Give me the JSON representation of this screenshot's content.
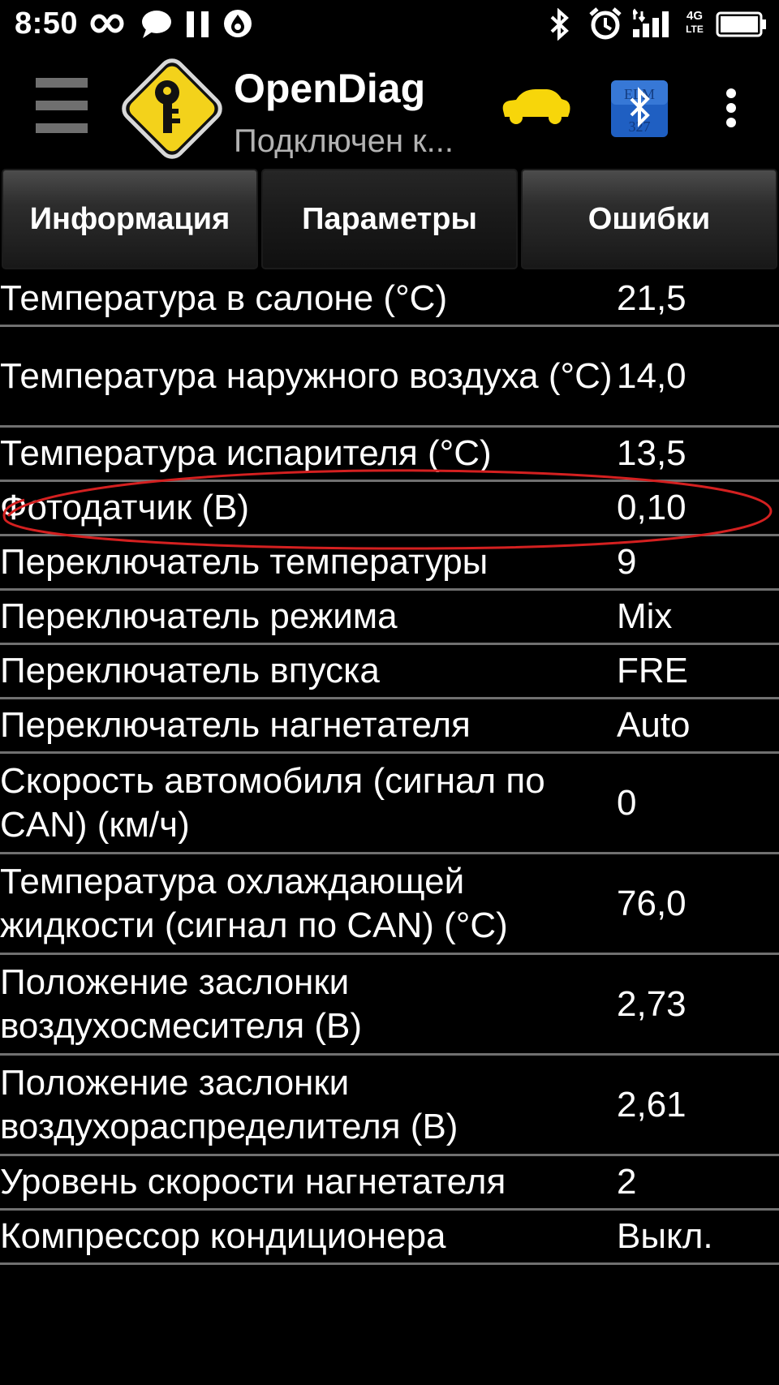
{
  "status_bar": {
    "time": "8:50",
    "network_label_top": "4G",
    "network_label_bottom": "LTE",
    "icons": [
      "infinity-icon",
      "chat-bubble-icon",
      "pause-icon",
      "drop-icon",
      "bluetooth-icon",
      "alarm-icon",
      "signal-icon",
      "battery-icon"
    ]
  },
  "app_bar": {
    "title": "OpenDiag",
    "subtitle": "Подключен к...",
    "bt_badge_text": "ELM 327",
    "colors": {
      "logo_yellow": "#f3d21b",
      "car_yellow": "#f7d60a",
      "bt_blue": "#1f5fc2"
    }
  },
  "tabs": [
    {
      "label": "Информация",
      "active": false
    },
    {
      "label": "Параметры",
      "active": true
    },
    {
      "label": "Ошибки",
      "active": false
    }
  ],
  "params": [
    {
      "label": "Температура в салоне (°C)",
      "value": "21,5"
    },
    {
      "label": "Температура наружного воздуха (°C)",
      "value": "14,0"
    },
    {
      "label": "Температура испарителя (°C)",
      "value": "13,5"
    },
    {
      "label": "Фотодатчик (В)",
      "value": "0,10",
      "highlighted": true
    },
    {
      "label": "Переключатель температуры",
      "value": "9"
    },
    {
      "label": "Переключатель режима",
      "value": "Mix"
    },
    {
      "label": "Переключатель впуска",
      "value": "FRE"
    },
    {
      "label": "Переключатель нагнетателя",
      "value": "Auto"
    },
    {
      "label": "Скорость автомобиля (сигнал по CAN) (км/ч)",
      "value": "0"
    },
    {
      "label": "Температура охлаждающей жидкости (сигнал по CAN) (°C)",
      "value": "76,0"
    },
    {
      "label": "Положение заслонки воздухосмесителя (В)",
      "value": "2,73"
    },
    {
      "label": "Положение заслонки воздухораспределителя (В)",
      "value": "2,61"
    },
    {
      "label": "Уровень скорости нагнетателя",
      "value": "2"
    },
    {
      "label": "Компрессор кондиционера",
      "value": "Выкл."
    }
  ],
  "annotation": {
    "color": "#d42020"
  }
}
